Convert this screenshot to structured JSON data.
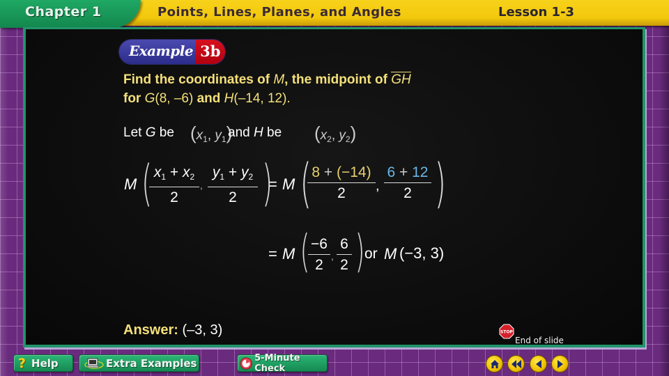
{
  "header": {
    "chapter": "Chapter 1",
    "title": "Points, Lines, Planes, and Angles",
    "lesson": "Lesson 1-3"
  },
  "example": {
    "word": "Example",
    "number": "3b"
  },
  "problem": {
    "line1_prefix": "Find the coordinates of ",
    "line1_var": "M",
    "line1_mid": ", the midpoint of ",
    "segment": "GH",
    "line2_for": "for ",
    "g_label": "G",
    "g_coords": "(8, –6)",
    "and": " and ",
    "h_label": "H",
    "h_coords": "(–14, 12)."
  },
  "let_line": {
    "let": "Let ",
    "g": "G",
    "be": " be ",
    "and": "and ",
    "h": "H",
    "be2": " be",
    "p1_x": "x",
    "p1_xsub": "1",
    "p1_y": "y",
    "p1_ysub": "1",
    "p2_x": "x",
    "p2_xsub": "2",
    "p2_y": "y",
    "p2_ysub": "2"
  },
  "formula": {
    "m": "M",
    "num1_a": "x",
    "num1_a_sub": "1",
    "plus": " + ",
    "num1_b": "x",
    "num1_b_sub": "2",
    "num2_a": "y",
    "num2_a_sub": "1",
    "num2_b": "y",
    "num2_b_sub": "2",
    "den": "2",
    "equals": "=",
    "sub_num1_a": "8",
    "sub_num1_op": " + ",
    "sub_num1_b": "(−14)",
    "sub_num2_a": "6",
    "sub_num2_op": " + ",
    "sub_num2_b": "12",
    "comma": ","
  },
  "result": {
    "equals": "=",
    "m": "M",
    "num1": "−6",
    "num2": "6",
    "den": "2",
    "or": "or",
    "m2": "M",
    "final": "(−3, 3)"
  },
  "answer": {
    "label": "Answer:",
    "value": "(–3, 3)"
  },
  "end_of_slide": {
    "stop_text": "STOP",
    "label": "End of slide"
  },
  "nav": {
    "help": "Help",
    "extra_examples": "Extra Examples",
    "five_minute_check": "5-Minute Check",
    "icons": [
      "home-icon",
      "rewind-icon",
      "previous-icon",
      "next-icon"
    ]
  },
  "colors": {
    "header_yellow": "#f2c80c",
    "header_green": "#13874d",
    "background_purple": "#6a2a7e",
    "slide_border_green": "#21946a",
    "text_yellow": "#f4e07a",
    "text_blue": "#6ab8e8"
  }
}
